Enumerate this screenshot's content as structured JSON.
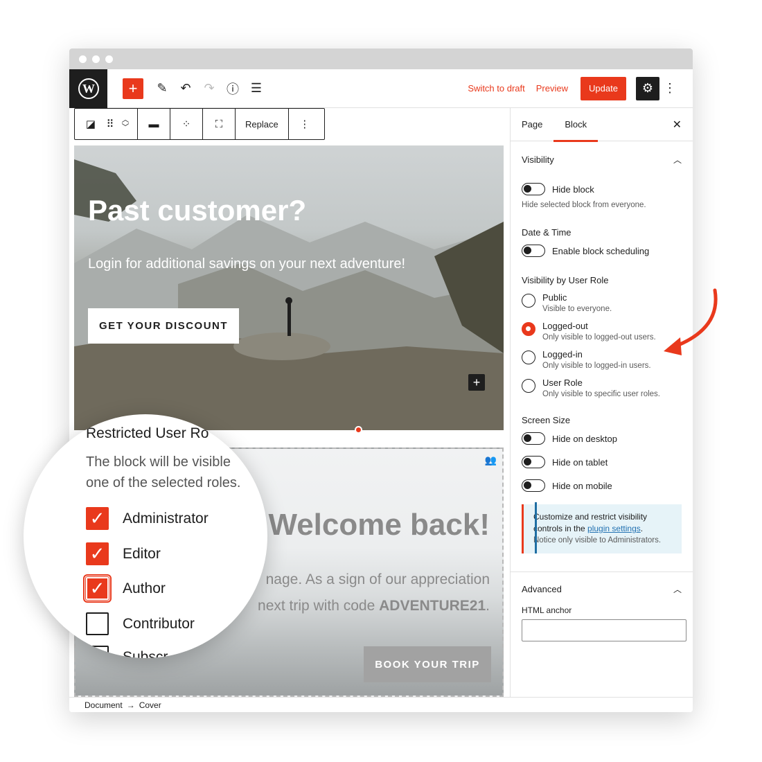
{
  "topbar": {
    "switch_to_draft": "Switch to draft",
    "preview": "Preview",
    "update": "Update"
  },
  "block_toolbar": {
    "replace": "Replace"
  },
  "cover_past_customer": {
    "title": "Past customer?",
    "subtitle": "Login for additional savings on your next adventure!",
    "button": "GET YOUR DISCOUNT"
  },
  "cover_welcome": {
    "title": "Welcome back!",
    "text_line1": "nage. As a sign of our appreciation",
    "text_line2_prefix": "next trip with code ",
    "code": "ADVENTURE21",
    "text_line2_suffix": ".",
    "button": "BOOK YOUR TRIP"
  },
  "footer": {
    "breadcrumb_document": "Document",
    "breadcrumb_arrow": "→",
    "breadcrumb_cover": "Cover"
  },
  "sidebar": {
    "tabs": [
      "Page",
      "Block"
    ],
    "active_tab": "Block",
    "visibility_title": "Visibility",
    "hide_block_label": "Hide block",
    "hide_block_help": "Hide selected block from everyone.",
    "date_time_title": "Date & Time",
    "enable_scheduling_label": "Enable block scheduling",
    "user_role_title": "Visibility by User Role",
    "roles": [
      {
        "title": "Public",
        "desc": "Visible to everyone.",
        "selected": false
      },
      {
        "title": "Logged-out",
        "desc": "Only visible to logged-out users.",
        "selected": true
      },
      {
        "title": "Logged-in",
        "desc": "Only visible to logged-in users.",
        "selected": false
      },
      {
        "title": "User Role",
        "desc": "Only visible to specific user roles.",
        "selected": false
      }
    ],
    "screen_size_title": "Screen Size",
    "hide_desktop": "Hide on desktop",
    "hide_tablet": "Hide on tablet",
    "hide_mobile": "Hide on mobile",
    "notice_line1": "Customize and restrict visibility",
    "notice_line2_prefix": "controls in the ",
    "notice_link": "plugin settings",
    "notice_line2_suffix": ".",
    "notice_small": "Notice only visible to Administrators.",
    "advanced_title": "Advanced",
    "html_anchor_label": "HTML anchor"
  },
  "magnifier": {
    "title": "Restricted User Ro",
    "text_line1": "The block will be visible",
    "text_line2": "one of the selected roles.",
    "roles": [
      {
        "label": "Administrator",
        "checked": true
      },
      {
        "label": "Editor",
        "checked": true
      },
      {
        "label": "Author",
        "checked": true
      },
      {
        "label": "Contributor",
        "checked": false
      }
    ],
    "partial_label": "Subscr"
  },
  "colors": {
    "accent": "#e9391c",
    "dark": "#1e1e1e",
    "notice_bg": "#e6f3f8"
  }
}
